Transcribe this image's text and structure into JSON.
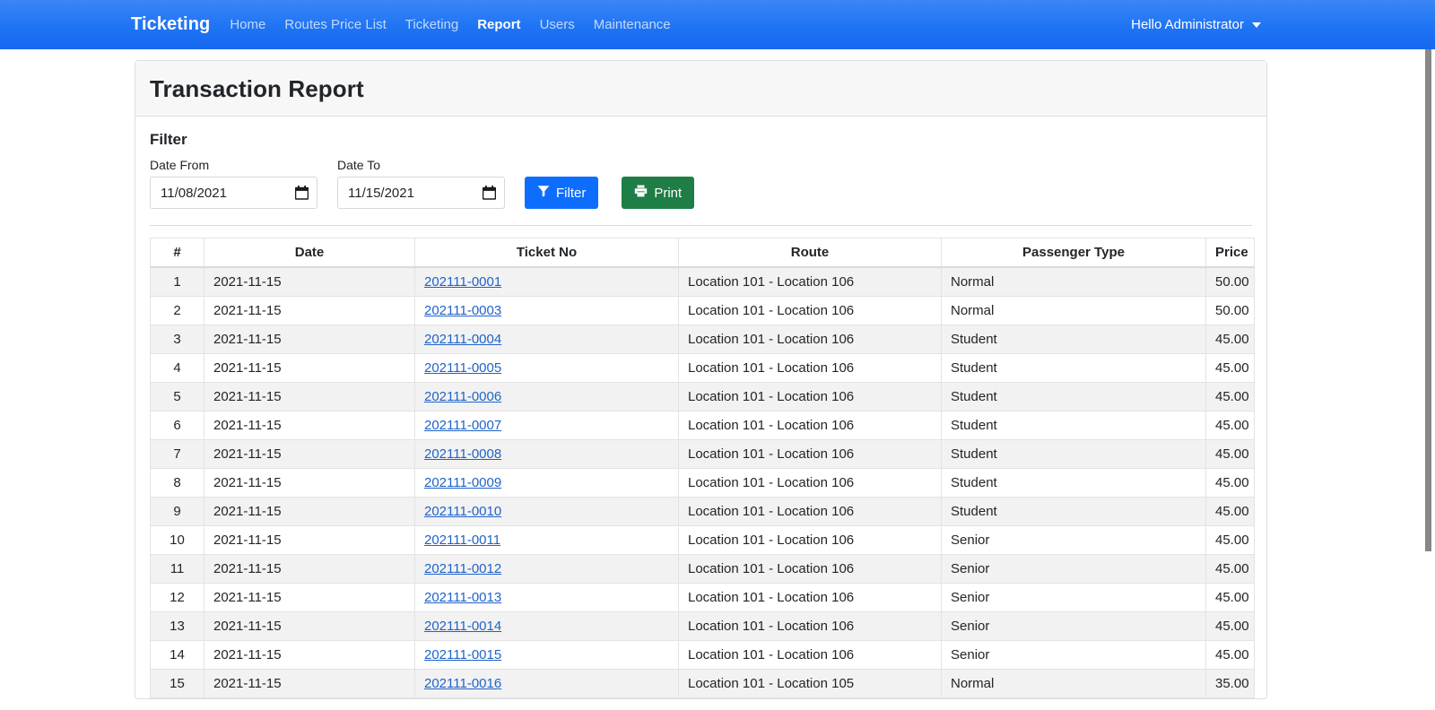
{
  "navbar": {
    "brand": "Ticketing",
    "links": [
      {
        "label": "Home",
        "active": false
      },
      {
        "label": "Routes Price List",
        "active": false
      },
      {
        "label": "Ticketing",
        "active": false
      },
      {
        "label": "Report",
        "active": true
      },
      {
        "label": "Users",
        "active": false
      },
      {
        "label": "Maintenance",
        "active": false
      }
    ],
    "user_greeting": "Hello Administrator",
    "brand_color": "#2878f5"
  },
  "card": {
    "title": "Transaction Report"
  },
  "filter": {
    "heading": "Filter",
    "date_from_label": "Date From",
    "date_from_value": "11/08/2021",
    "date_to_label": "Date To",
    "date_to_value": "11/15/2021",
    "filter_button": "Filter",
    "print_button": "Print",
    "filter_button_color": "#0d6efd",
    "print_button_color": "#1e7e45"
  },
  "table": {
    "columns": [
      "#",
      "Date",
      "Ticket No",
      "Route",
      "Passenger Type",
      "Price"
    ],
    "rows": [
      {
        "idx": "1",
        "date": "2021-11-15",
        "ticket": "202111-0001",
        "route": "Location 101 - Location 106",
        "ptype": "Normal",
        "price": "50.00"
      },
      {
        "idx": "2",
        "date": "2021-11-15",
        "ticket": "202111-0003",
        "route": "Location 101 - Location 106",
        "ptype": "Normal",
        "price": "50.00"
      },
      {
        "idx": "3",
        "date": "2021-11-15",
        "ticket": "202111-0004",
        "route": "Location 101 - Location 106",
        "ptype": "Student",
        "price": "45.00"
      },
      {
        "idx": "4",
        "date": "2021-11-15",
        "ticket": "202111-0005",
        "route": "Location 101 - Location 106",
        "ptype": "Student",
        "price": "45.00"
      },
      {
        "idx": "5",
        "date": "2021-11-15",
        "ticket": "202111-0006",
        "route": "Location 101 - Location 106",
        "ptype": "Student",
        "price": "45.00"
      },
      {
        "idx": "6",
        "date": "2021-11-15",
        "ticket": "202111-0007",
        "route": "Location 101 - Location 106",
        "ptype": "Student",
        "price": "45.00"
      },
      {
        "idx": "7",
        "date": "2021-11-15",
        "ticket": "202111-0008",
        "route": "Location 101 - Location 106",
        "ptype": "Student",
        "price": "45.00"
      },
      {
        "idx": "8",
        "date": "2021-11-15",
        "ticket": "202111-0009",
        "route": "Location 101 - Location 106",
        "ptype": "Student",
        "price": "45.00"
      },
      {
        "idx": "9",
        "date": "2021-11-15",
        "ticket": "202111-0010",
        "route": "Location 101 - Location 106",
        "ptype": "Student",
        "price": "45.00"
      },
      {
        "idx": "10",
        "date": "2021-11-15",
        "ticket": "202111-0011",
        "route": "Location 101 - Location 106",
        "ptype": "Senior",
        "price": "45.00"
      },
      {
        "idx": "11",
        "date": "2021-11-15",
        "ticket": "202111-0012",
        "route": "Location 101 - Location 106",
        "ptype": "Senior",
        "price": "45.00"
      },
      {
        "idx": "12",
        "date": "2021-11-15",
        "ticket": "202111-0013",
        "route": "Location 101 - Location 106",
        "ptype": "Senior",
        "price": "45.00"
      },
      {
        "idx": "13",
        "date": "2021-11-15",
        "ticket": "202111-0014",
        "route": "Location 101 - Location 106",
        "ptype": "Senior",
        "price": "45.00"
      },
      {
        "idx": "14",
        "date": "2021-11-15",
        "ticket": "202111-0015",
        "route": "Location 101 - Location 106",
        "ptype": "Senior",
        "price": "45.00"
      },
      {
        "idx": "15",
        "date": "2021-11-15",
        "ticket": "202111-0016",
        "route": "Location 101 - Location 105",
        "ptype": "Normal",
        "price": "35.00"
      }
    ]
  },
  "icons": {
    "calendar": "calendar-icon",
    "funnel": "funnel-icon",
    "printer": "printer-icon",
    "caret": "chevron-down-icon"
  }
}
